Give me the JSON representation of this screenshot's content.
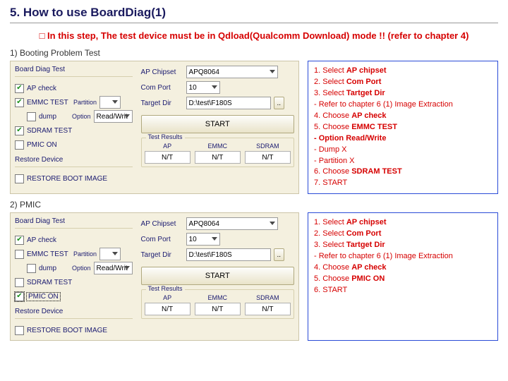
{
  "title": "5. How to use BoardDiag(1)",
  "warning": "□ In this step, The test device must be in Qdload(Qualcomm Download) mode !! (refer to chapter 4)",
  "section1": {
    "heading": "1)   Booting Problem Test",
    "panel": {
      "group1": "Board Diag Test",
      "ap_check": "AP check",
      "emmc": "EMMC TEST",
      "dump": "dump",
      "partition_lbl": "Partition",
      "option_lbl": "Option",
      "option_val": "Read/Writ",
      "sdram": "SDRAM TEST",
      "pmic": "PMIC ON",
      "group2": "Restore Device",
      "restore": "RESTORE BOOT IMAGE",
      "ap_chipset_lbl": "AP Chipset",
      "ap_chipset_val": "APQ8064",
      "comport_lbl": "Com Port",
      "comport_val": "10",
      "target_lbl": "Target Dir",
      "target_val": "D:\\test\\F180S",
      "browse": "..",
      "start": "START",
      "results_title": "Test Results",
      "res_ap_h": "AP",
      "res_emmc_h": "EMMC",
      "res_sdram_h": "SDRAM",
      "res_val": "N/T"
    },
    "instr": {
      "l1a": "1. Select ",
      "l1b": "AP chipset",
      "l2a": "2. Select ",
      "l2b": "Com Port",
      "l3a": "3. Select ",
      "l3b": "Tartget Dir",
      "l4": "- Refer to chapter 6 (1) Image Extraction",
      "l5a": "4. Choose ",
      "l5b": "AP check",
      "l6a": "5. Choose ",
      "l6b": "EMMC TEST",
      "l7": "- Option Read/Write",
      "l8": "-  Dump X",
      "l9": "-  Partition X",
      "l10a": "6. Choose ",
      "l10b": "SDRAM TEST",
      "l11": "7. START"
    }
  },
  "section2": {
    "heading": "2) PMIC",
    "instr": {
      "l1a": "1. Select ",
      "l1b": "AP chipset",
      "l2a": "2. Select ",
      "l2b": "Com Port",
      "l3a": "3. Select ",
      "l3b": "Tartget Dir",
      "l4": "- Refer to chapter 6 (1) Image Extraction",
      "l5a": "4. Choose ",
      "l5b": "AP check",
      "l6a": "5. Choose ",
      "l6b": "PMIC ON",
      "l7": "6. START"
    }
  }
}
